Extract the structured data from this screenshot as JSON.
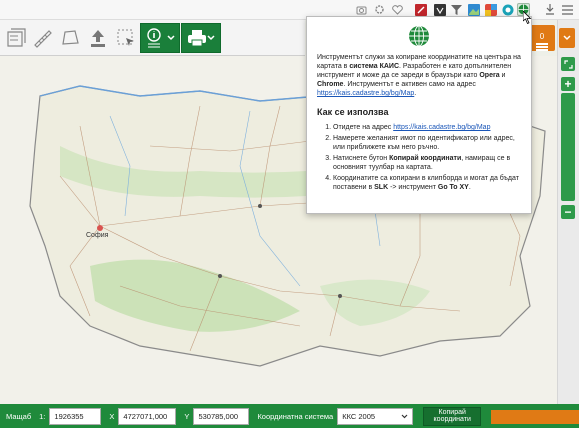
{
  "popup": {
    "intro_pre": "Инструментът служи за копиране координатите на центъра на картата в ",
    "intro_bold": "система КАИС",
    "intro_post": ". Разработен е като допълнителен инструмент и може да се зареди в браузъри като ",
    "opera": "Opera",
    "and_word": " и ",
    "chrome": "Chrome",
    "intro_end": ". Инструментът е активен само на адрес",
    "address_link": "https://kais.cadastre.bg/bg/Map",
    "heading": "Как се използва",
    "step1_pre": "Отидете на адрес ",
    "step1_link": "https://kais.cadastre.bg/bg/Map",
    "step2": "Намерете желаният имот по идентификатор или адрес, или приближете към него ръчно.",
    "step3_pre": "Натиснете бутон ",
    "step3_bold": "Копирай координати",
    "step3_post": ", намиращ се в основният туулбар на картата.",
    "step4_pre": "Координатите са копирани в клипборда и могат да бъдат поставени в ",
    "step4_slk": "SLK",
    "step4_mid": " -> инструмент ",
    "step4_goto": "Go To XY",
    "step4_end": "."
  },
  "map": {
    "city_label": "София"
  },
  "bottombar": {
    "scale_label": "Мащаб",
    "scale_prefix": "1:",
    "scale_value": "1926355",
    "x_label": "X",
    "x_value": "4727071,000",
    "y_label": "Y",
    "y_value": "530785,000",
    "crs_label": "Координатна система",
    "crs_value": "ККС 2005",
    "copy_button": "Копирай координати"
  },
  "right_panel": {
    "orange_badge": "0"
  },
  "icons": [
    "layers-icon",
    "ruler-icon",
    "polygon-icon",
    "upload-icon",
    "select-icon",
    "info-icon",
    "print-icon",
    "camera-icon",
    "gear-icon",
    "heart-icon",
    "pdf-icon",
    "download-icon",
    "menu-icon",
    "globe-icon"
  ],
  "colors": {
    "accent_green": "#1f8a3b",
    "accent_orange": "#e07a15",
    "link_blue": "#1a56b8"
  }
}
